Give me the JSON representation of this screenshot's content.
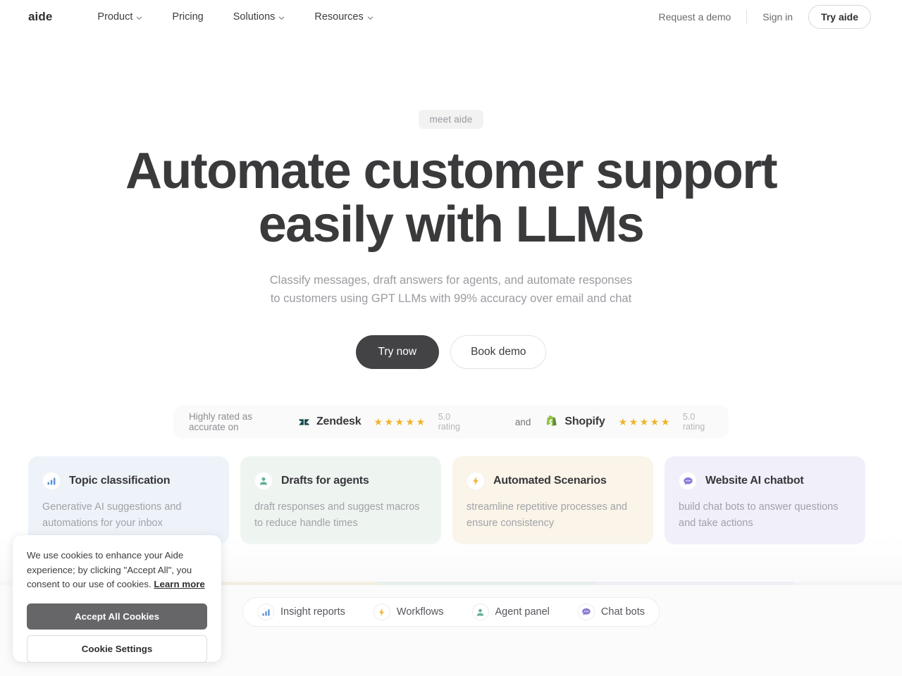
{
  "nav": {
    "logo": "aide",
    "links": [
      {
        "label": "Product",
        "has_caret": true,
        "icon": "chevron-down-icon"
      },
      {
        "label": "Pricing",
        "has_caret": false,
        "icon": ""
      },
      {
        "label": "Solutions",
        "has_caret": true,
        "icon": "chevron-down-icon"
      },
      {
        "label": "Resources",
        "has_caret": true,
        "icon": "chevron-down-icon"
      }
    ],
    "request_demo": "Request a demo",
    "sign_in": "Sign in",
    "try_aide": "Try aide"
  },
  "hero": {
    "eyebrow": "meet aide",
    "title_line1": "Automate customer support",
    "title_line2": "easily with LLMs",
    "subtitle": "Classify messages, draft answers for agents, and automate responses to customers using GPT LLMs with 99% accuracy over email and chat",
    "cta_primary": "Try now",
    "cta_secondary": "Book demo"
  },
  "ratings": {
    "label": "Highly rated as accurate on",
    "conjunction": "and",
    "stars": "★★★★★",
    "items": [
      {
        "brand": "Zendesk",
        "icon": "zendesk-logo-icon",
        "rating": "5.0 rating",
        "color": "#17494d"
      },
      {
        "brand": "Shopify",
        "icon": "shopify-logo-icon",
        "rating": "5.0 rating",
        "color": "#95bf47"
      }
    ]
  },
  "cards": [
    {
      "title": "Topic classification",
      "desc": "Generative AI suggestions and automations for your inbox",
      "icon": "bar-chart-icon",
      "theme": "c-blue",
      "accent": "#5f97d8"
    },
    {
      "title": "Drafts for agents",
      "desc": "draft responses and suggest macros to reduce handle times",
      "icon": "person-icon",
      "theme": "c-green",
      "accent": "#63b392"
    },
    {
      "title": "Automated Scenarios",
      "desc": "streamline repetitive processes and ensure consistency",
      "icon": "lightning-bolt-icon",
      "theme": "c-amber",
      "accent": "#efb429"
    },
    {
      "title": "Website AI chatbot",
      "desc": "build chat bots to answer questions and take actions",
      "icon": "chat-bubble-icon",
      "theme": "c-purple",
      "accent": "#8b7ed8"
    }
  ],
  "tabs": [
    {
      "label": "Insight reports",
      "icon": "bar-chart-icon",
      "accent": "#5f97d8"
    },
    {
      "label": "Workflows",
      "icon": "lightning-bolt-icon",
      "accent": "#efb429"
    },
    {
      "label": "Agent panel",
      "icon": "person-icon",
      "accent": "#63b392"
    },
    {
      "label": "Chat bots",
      "icon": "chat-bubble-icon",
      "accent": "#8b7ed8"
    }
  ],
  "cookie": {
    "text": "We use cookies to enhance your Aide experience; by clicking \"Accept All\", you consent to our use of cookies. ",
    "link": "Learn more",
    "accept": "Accept All Cookies",
    "settings": "Cookie Settings"
  },
  "colors": {
    "text_dark": "#3a3a3c",
    "text_muted": "#9b9ba1",
    "primary_button": "#434345",
    "star": "#efb429"
  }
}
